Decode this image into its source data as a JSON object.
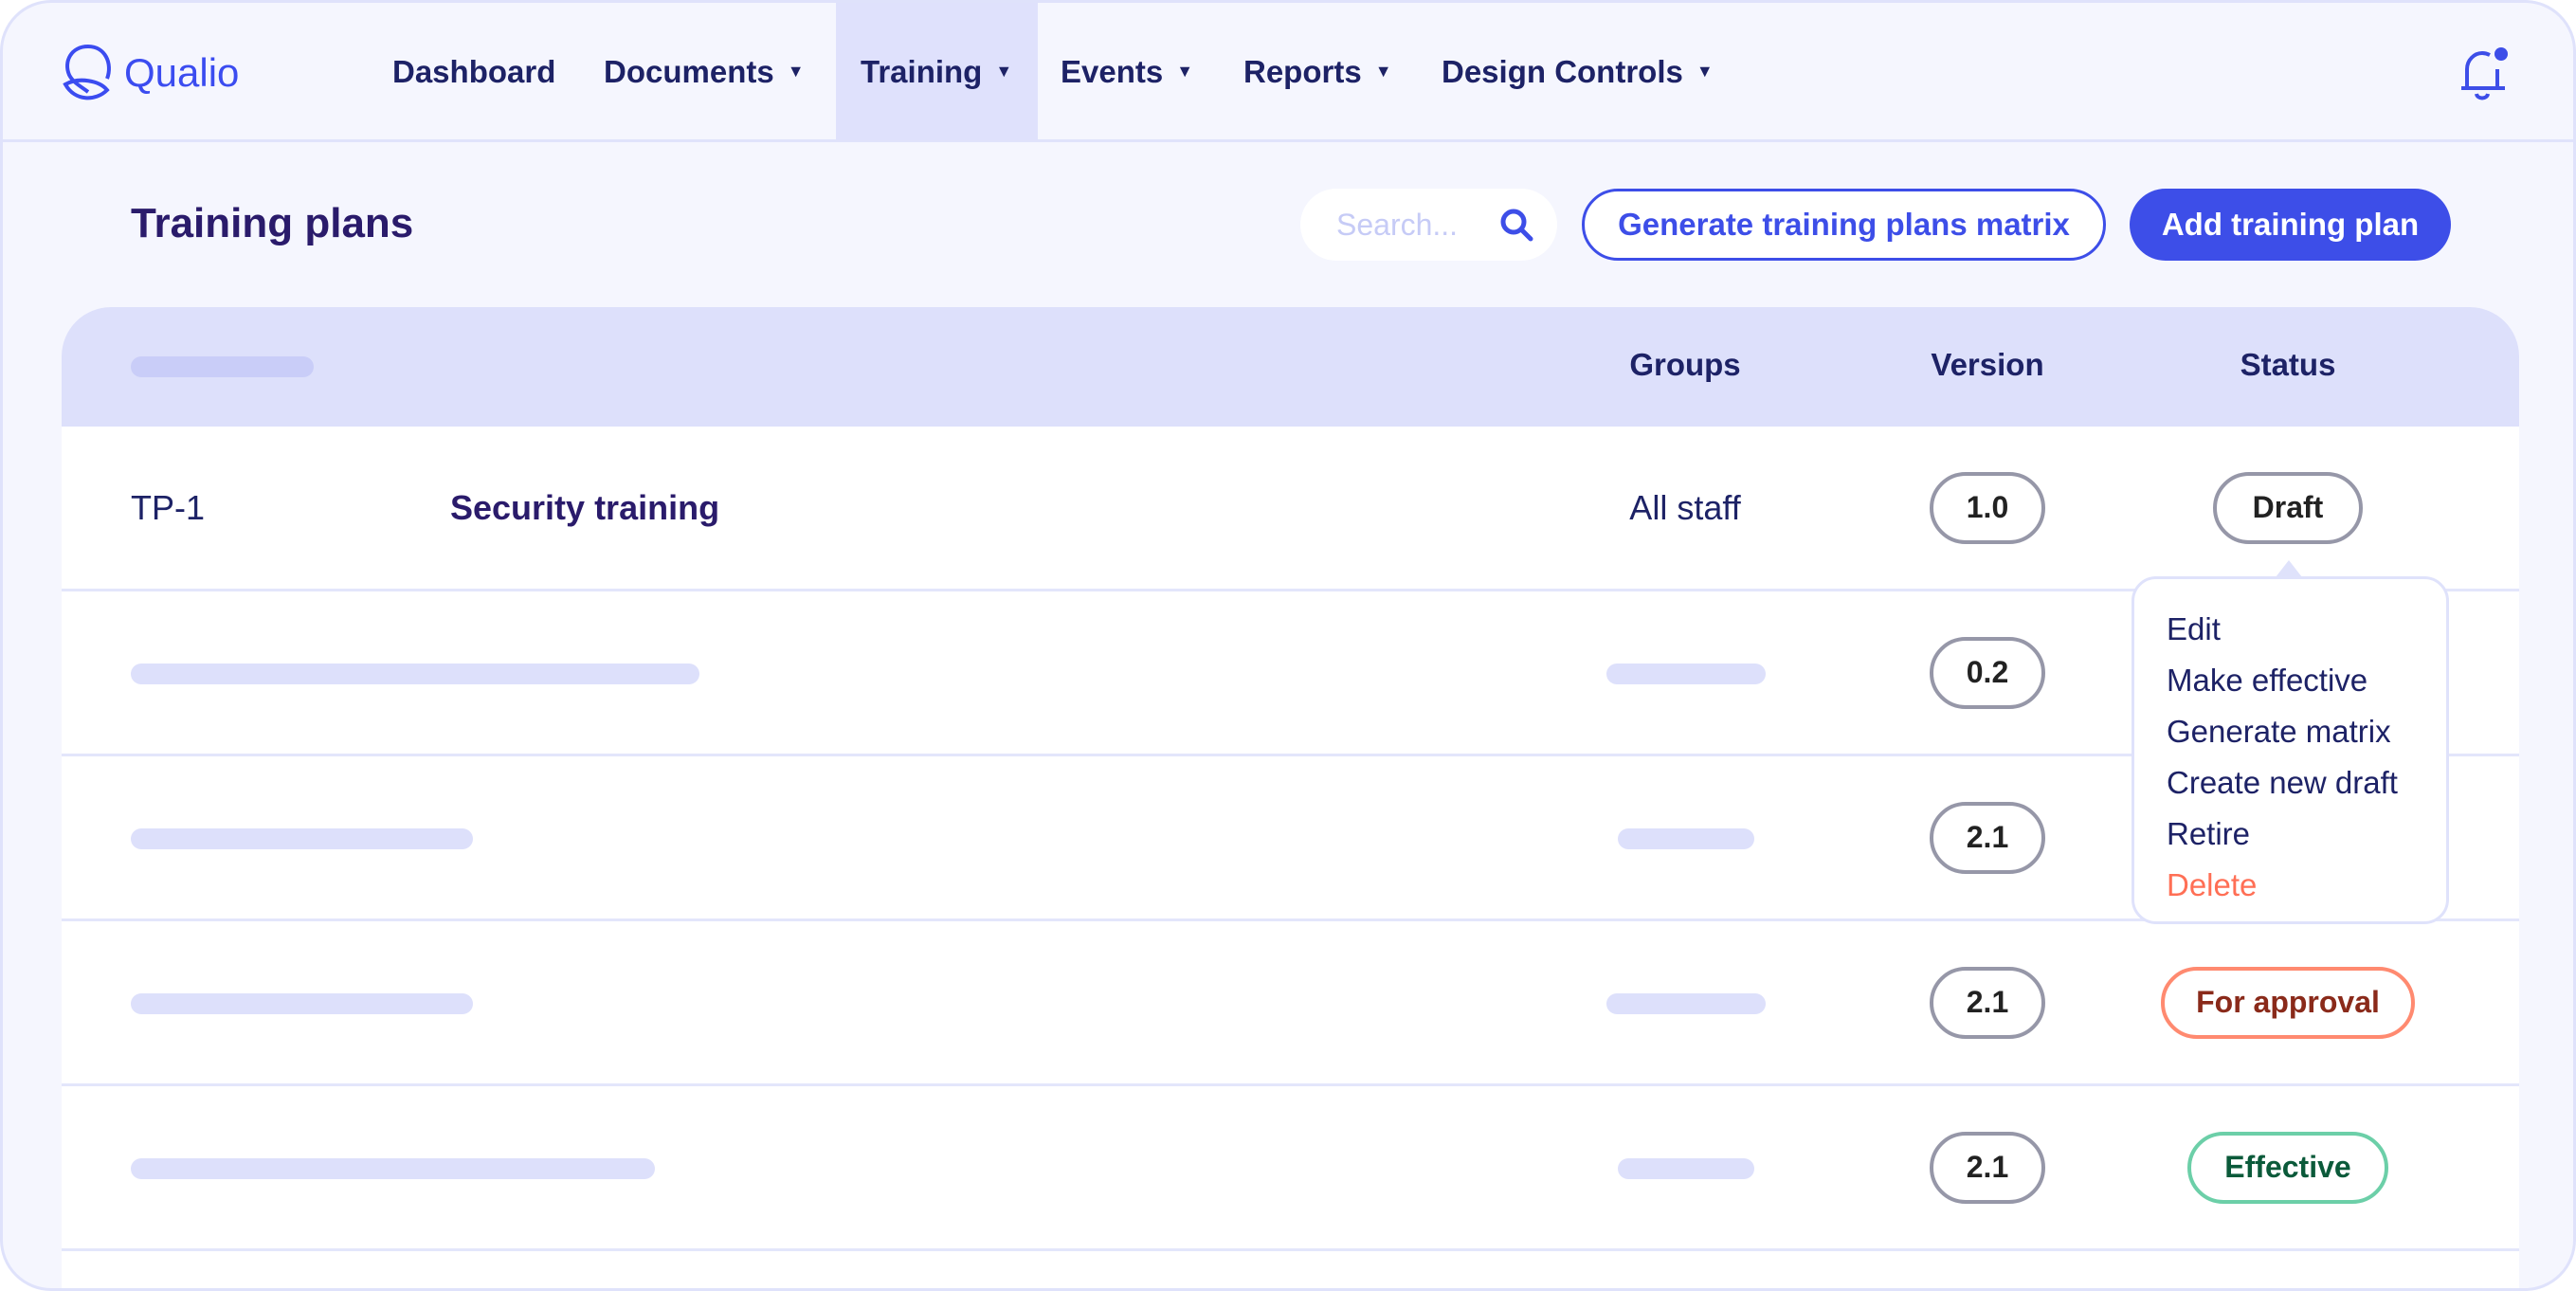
{
  "brand": {
    "name": "Qualio",
    "accent": "#3d4ee8"
  },
  "nav": {
    "items": [
      {
        "label": "Dashboard",
        "dropdown": false
      },
      {
        "label": "Documents",
        "dropdown": true
      },
      {
        "label": "Training",
        "dropdown": true,
        "active": true
      },
      {
        "label": "Events",
        "dropdown": true
      },
      {
        "label": "Reports",
        "dropdown": true
      },
      {
        "label": "Design Controls",
        "dropdown": true
      }
    ],
    "caret": "▼"
  },
  "page": {
    "title": "Training plans"
  },
  "search": {
    "placeholder": "Search..."
  },
  "buttons": {
    "generate": "Generate training plans matrix",
    "add": "Add training plan"
  },
  "table": {
    "headers": {
      "groups": "Groups",
      "version": "Version",
      "status": "Status"
    },
    "rows": [
      {
        "id": "TP-1",
        "name": "Security training",
        "groups": "All staff",
        "version": "1.0",
        "status": "Draft"
      },
      {
        "version": "0.2"
      },
      {
        "version": "2.1"
      },
      {
        "version": "2.1",
        "status": "For approval"
      },
      {
        "version": "2.1",
        "status": "Effective"
      }
    ]
  },
  "menu": {
    "items": [
      "Edit",
      "Make effective",
      "Generate matrix",
      "Create new draft",
      "Retire"
    ],
    "danger_item": "Delete"
  },
  "status_colors": {
    "draft": "#9697a8",
    "for_approval": "#ff8a70",
    "effective": "#6ccfa8"
  }
}
